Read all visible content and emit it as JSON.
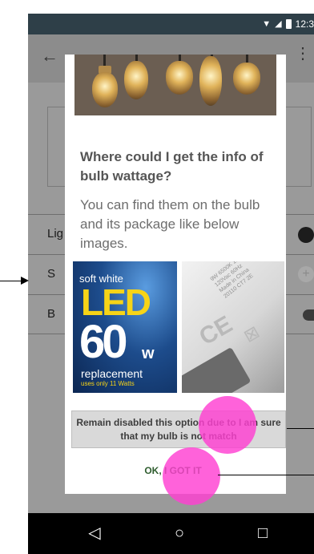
{
  "status_bar": {
    "time": "12:3"
  },
  "background": {
    "rows": [
      {
        "label": "Lig"
      },
      {
        "label": "S"
      },
      {
        "label": "B"
      }
    ]
  },
  "dialog": {
    "title": "Where could I get the info of bulb wattage?",
    "body": "You can find them on the bulb and its package like below images.",
    "led_image": {
      "line1": "soft white",
      "line2": "LED",
      "line3": "60",
      "line3_unit": "w",
      "line4": "replacement",
      "line5": "uses only 11 Watts"
    },
    "bulb_image": {
      "print": "9W 6500K 100mA\n120Vac 60Hz\nMade in China\n20110 CT7 2E",
      "ce_mark": "CE"
    },
    "disable_button_label": "Remain disabled this option due to I am sure that my bulb is not match",
    "ok_button_label": "OK, I GOT IT"
  },
  "colors": {
    "status_bar": "#2e3f48",
    "touch_marker": "#ff3fd2",
    "ok_text": "#2f5d2f"
  }
}
